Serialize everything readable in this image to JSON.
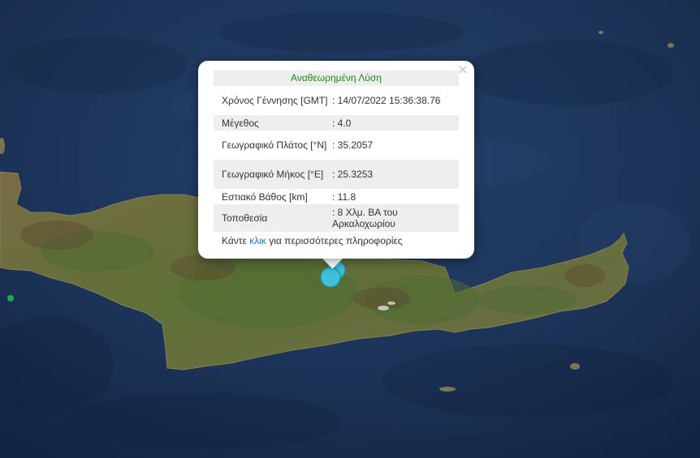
{
  "map": {
    "colors": {
      "sea": "#1c3357",
      "land": "#6e6a3c",
      "land_green": "#4f6b32",
      "marker": "#3ec6e3",
      "green_marker": "#1fa84a"
    }
  },
  "popup": {
    "close_label": "×",
    "title": "Αναθεωρημένη Λύση",
    "rows": [
      {
        "label": "Χρόνος Γέννησης [GMT]",
        "value": ": 14/07/2022 15:36:38.76"
      },
      {
        "label": "Μέγεθος",
        "value": ": 4.0"
      },
      {
        "label": "Γεωγραφικό Πλάτος [°N]",
        "value": ": 35.2057"
      },
      {
        "label": "Γεωγραφικό Μήκος [°E]",
        "value": ": 25.3253"
      },
      {
        "label": "Εστιακό Βάθος [km]",
        "value": ": 11.8"
      },
      {
        "label": "Τοποθεσία",
        "value": ": 8 Χλμ. ΒΑ του Αρκαλοχωρίου"
      }
    ],
    "footer": {
      "before": "Κάντε ",
      "link": "κλικ",
      "after": " για περισσότερες πληροφορίες"
    }
  }
}
